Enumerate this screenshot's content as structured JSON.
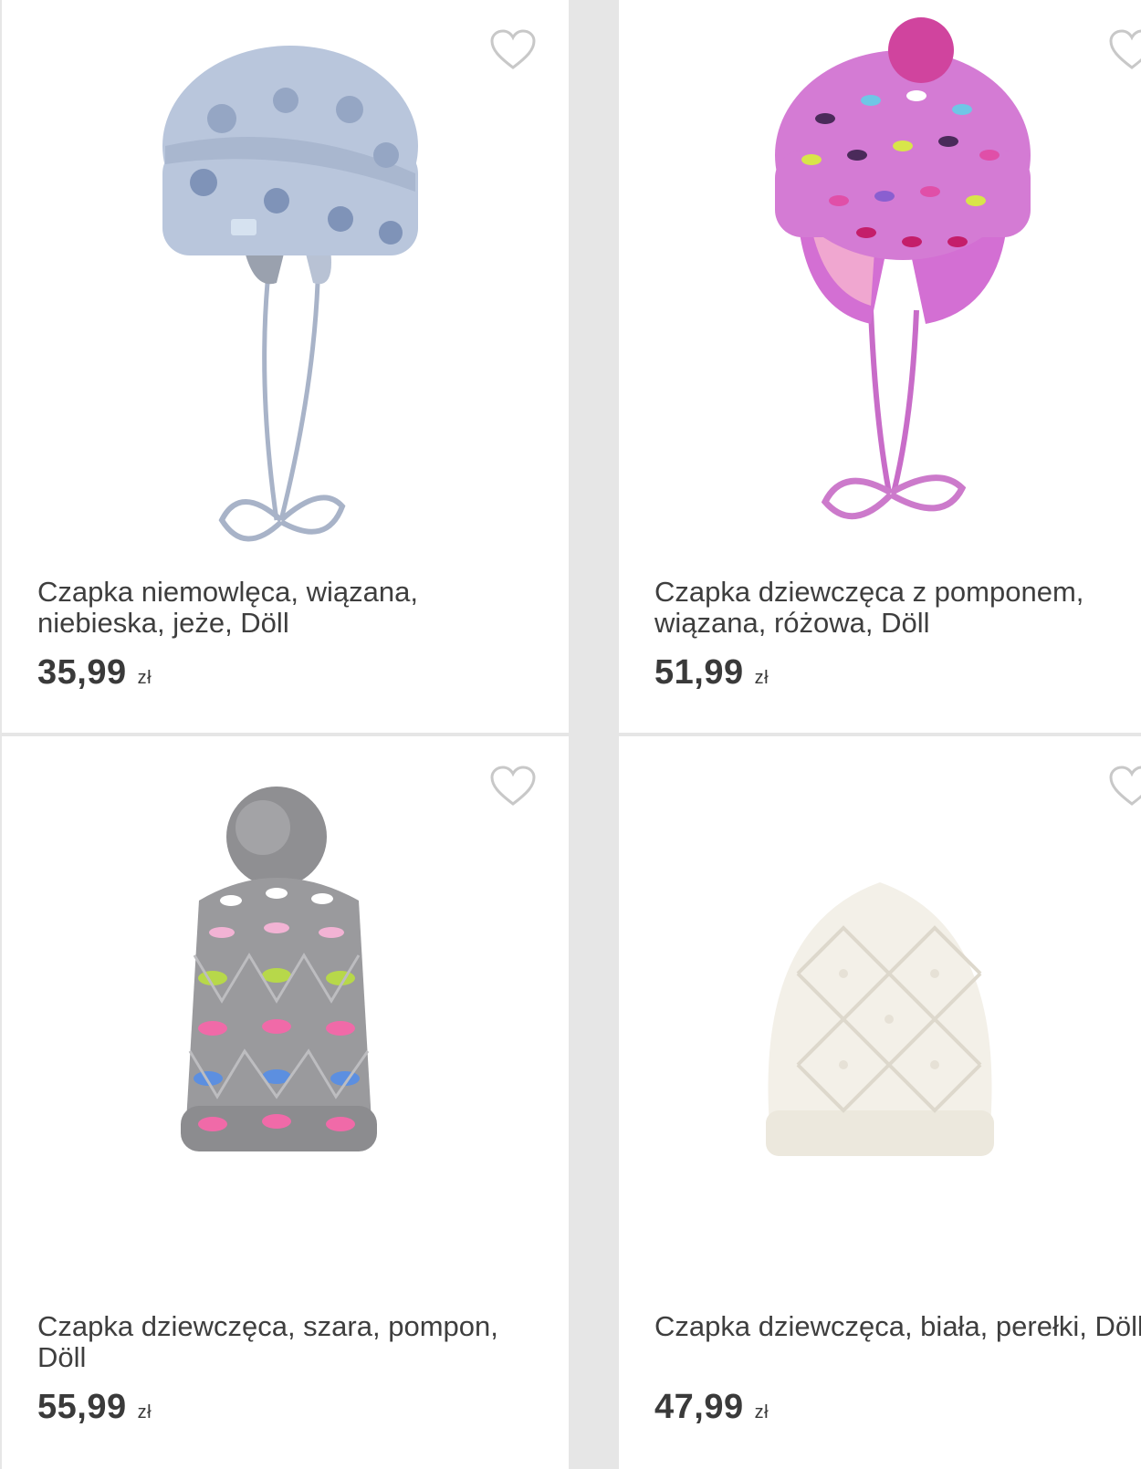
{
  "products": [
    {
      "title": "Czapka niemowlęca, wiązana, niebieska, jeże, Döll",
      "price": "35,99",
      "currency": "zł",
      "image_icon": "blue-baby-hat-image"
    },
    {
      "title": "Czapka dziewczęca z pomponem, wiązana, różowa, Döll",
      "price": "51,99",
      "currency": "zł",
      "image_icon": "pink-pompom-hat-image"
    },
    {
      "title": "Czapka dziewczęca, szara, pompon, Döll",
      "price": "55,99",
      "currency": "zł",
      "image_icon": "grey-pompom-hat-image"
    },
    {
      "title": "Czapka dziewczęca, biała, perełki, Döll",
      "price": "47,99",
      "currency": "zł",
      "image_icon": "white-knit-hat-image"
    }
  ],
  "colors": {
    "background": "#e6e6e6",
    "card": "#ffffff",
    "text": "#3e3e3e",
    "heart": "#c8c8c8"
  }
}
